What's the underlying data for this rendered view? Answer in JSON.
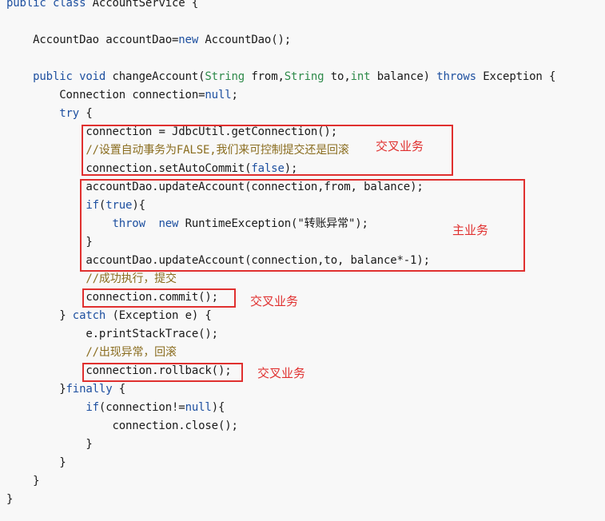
{
  "code": {
    "lines": [
      "public class AccountService {",
      "",
      "    AccountDao accountDao=new AccountDao();",
      "",
      "    public void changeAccount(String from,String to,int balance) throws Exception {",
      "        Connection connection=null;",
      "        try {",
      "            connection = JdbcUtil.getConnection();",
      "            //设置自动事务为FALSE,我们来可控制提交还是回滚",
      "            connection.setAutoCommit(false);",
      "            accountDao.updateAccount(connection,from, balance);",
      "            if(true){",
      "                throw  new RuntimeException(\"转账异常\");",
      "            }",
      "            accountDao.updateAccount(connection,to, balance*-1);",
      "            //成功执行，提交",
      "            connection.commit();",
      "        } catch (Exception e) {",
      "            e.printStackTrace();",
      "            //出现异常，回滚",
      "            connection.rollback();",
      "        }finally {",
      "            if(connection!=null){",
      "                connection.close();",
      "            }",
      "        }",
      "    }",
      "}"
    ]
  },
  "annotations": {
    "cross_business_1": "交叉业务",
    "main_business": "主业务",
    "cross_business_2": "交叉业务",
    "cross_business_3": "交叉业务"
  },
  "colors": {
    "keyword": "#1e50a0",
    "type": "#2e8a4a",
    "comment": "#8a6d1f",
    "highlight_box": "#e0302f",
    "background": "#f8f8f8"
  }
}
